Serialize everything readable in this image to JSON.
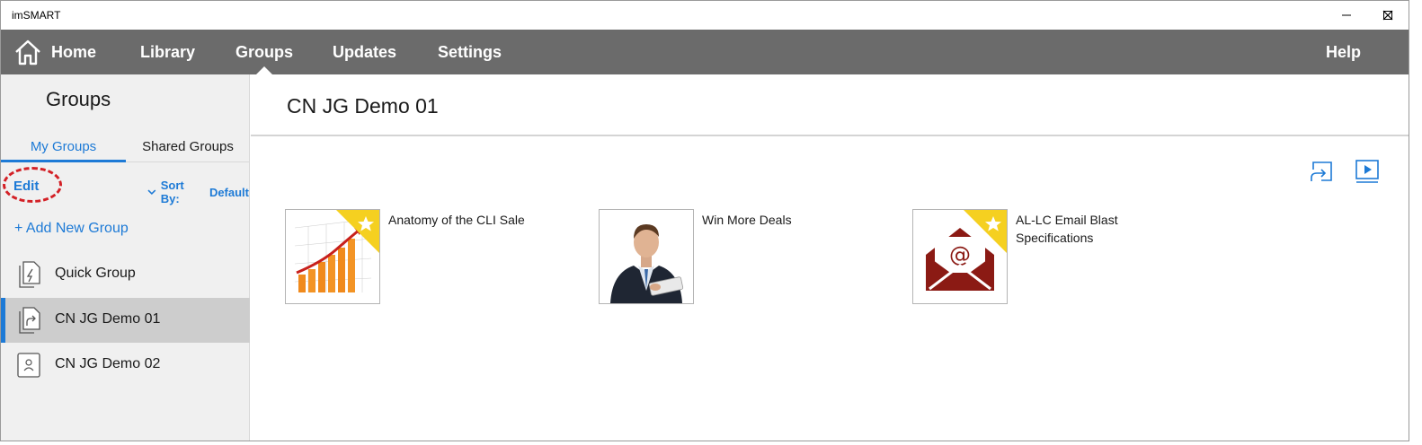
{
  "window": {
    "title": "imSMART"
  },
  "nav": {
    "items": [
      {
        "label": "Home"
      },
      {
        "label": "Library"
      },
      {
        "label": "Groups"
      },
      {
        "label": "Updates"
      },
      {
        "label": "Settings"
      }
    ],
    "help_label": "Help",
    "active": "Groups"
  },
  "sidebar": {
    "title": "Groups",
    "tabs": [
      {
        "label": "My Groups"
      },
      {
        "label": "Shared Groups"
      }
    ],
    "edit_label": "Edit",
    "sort_prefix": "Sort By:",
    "sort_value": "Default",
    "add_label": "+ Add New Group",
    "groups": [
      {
        "label": "Quick Group",
        "icon": "quick-group-icon"
      },
      {
        "label": "CN JG Demo 01",
        "icon": "shared-group-icon",
        "selected": true
      },
      {
        "label": "CN JG Demo 02",
        "icon": "person-group-icon"
      }
    ]
  },
  "main": {
    "title": "CN JG Demo 01",
    "actions": [
      {
        "icon": "share-icon"
      },
      {
        "icon": "play-icon"
      }
    ],
    "items": [
      {
        "title": "Anatomy of the CLI Sale",
        "thumb": "chart-thumbnail",
        "starred": true
      },
      {
        "title": "Win More Deals",
        "thumb": "businessman-thumbnail",
        "starred": false
      },
      {
        "title": "AL-LC Email Blast Specifications",
        "thumb": "email-thumbnail",
        "starred": true
      }
    ]
  },
  "colors": {
    "accent": "#1d7ad6",
    "navbar": "#6b6b6b",
    "highlight": "#d32026",
    "star_ribbon": "#f5d020"
  }
}
